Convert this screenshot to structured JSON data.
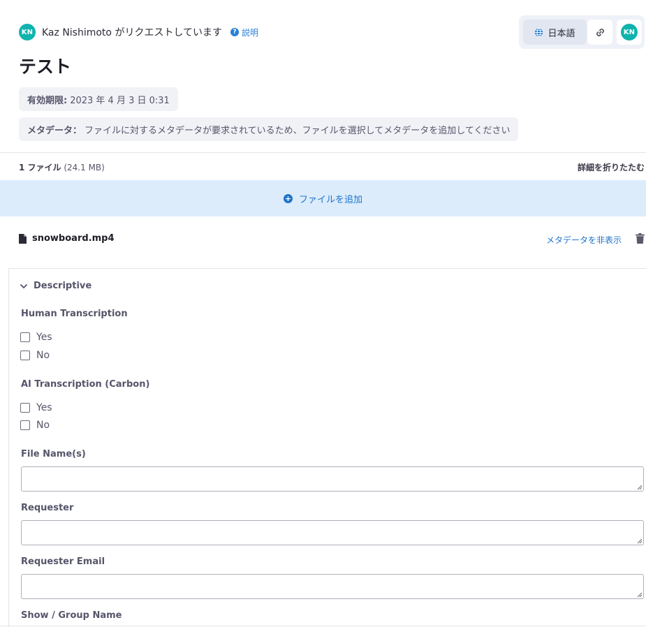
{
  "header": {
    "requester_initials": "KN",
    "requester_name": "Kaz Nishimoto",
    "request_text": "がリクエストしています",
    "help_label": "説明",
    "language_label": "日本語",
    "user_initials": "KN"
  },
  "request": {
    "title": "テスト",
    "expiry_label": "有効期限:",
    "expiry_value": "2023 年 4 月 3 日 0:31",
    "metadata_label": "メタデータ：",
    "metadata_message": "ファイルに対するメタデータが要求されているため、ファイルを選択してメタデータを追加してください"
  },
  "files": {
    "count_label": "1 ファイル",
    "total_size": "(24.1 MB)",
    "collapse_label": "詳細を折りたたむ",
    "add_label": "ファイルを追加",
    "items": [
      {
        "name": "snowboard.mp4",
        "hide_metadata_label": "メタデータを非表示"
      }
    ]
  },
  "metadata_form": {
    "section_title": "Descriptive",
    "fields": [
      {
        "label": "Human Transcription",
        "options": [
          "Yes",
          "No"
        ]
      },
      {
        "label": "AI Transcription (Carbon)",
        "options": [
          "Yes",
          "No"
        ]
      },
      {
        "label": "File Name(s)",
        "value": ""
      },
      {
        "label": "Requester",
        "value": ""
      },
      {
        "label": "Requester Email",
        "value": ""
      },
      {
        "label": "Show / Group Name"
      }
    ]
  },
  "colors": {
    "accent": "#1f73c9",
    "avatar": "#10b3ad",
    "add_bar_bg": "#dcecfb",
    "pill_bg": "#f1f2f6"
  },
  "icons": [
    "help-icon",
    "globe-icon",
    "link-icon",
    "plus-circle-icon",
    "file-icon",
    "trash-icon",
    "chevron-down-icon"
  ]
}
